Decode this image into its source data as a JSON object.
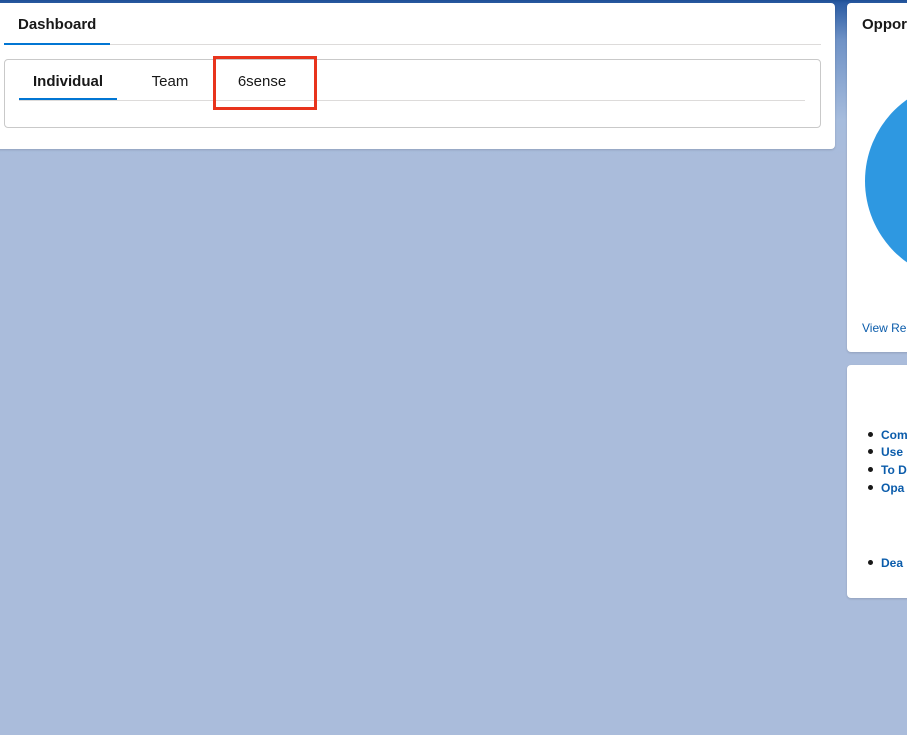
{
  "dashboard": {
    "tab_label": "Dashboard",
    "sub_tabs": [
      {
        "label": "Individual",
        "active": true
      },
      {
        "label": "Team",
        "active": false
      },
      {
        "label": "6sense",
        "active": false
      }
    ]
  },
  "opportunities_card": {
    "title": "Oppor",
    "link_label": "View Re"
  },
  "links_card": {
    "items": [
      {
        "label": "Com"
      },
      {
        "label": "Use"
      },
      {
        "label": "To D"
      },
      {
        "label": "Opa"
      },
      {
        "label": "Dea"
      }
    ]
  },
  "colors": {
    "accent": "#0176d3",
    "highlight": "#e8341c",
    "pie": "#2e98e1",
    "link": "#0b5cab"
  }
}
